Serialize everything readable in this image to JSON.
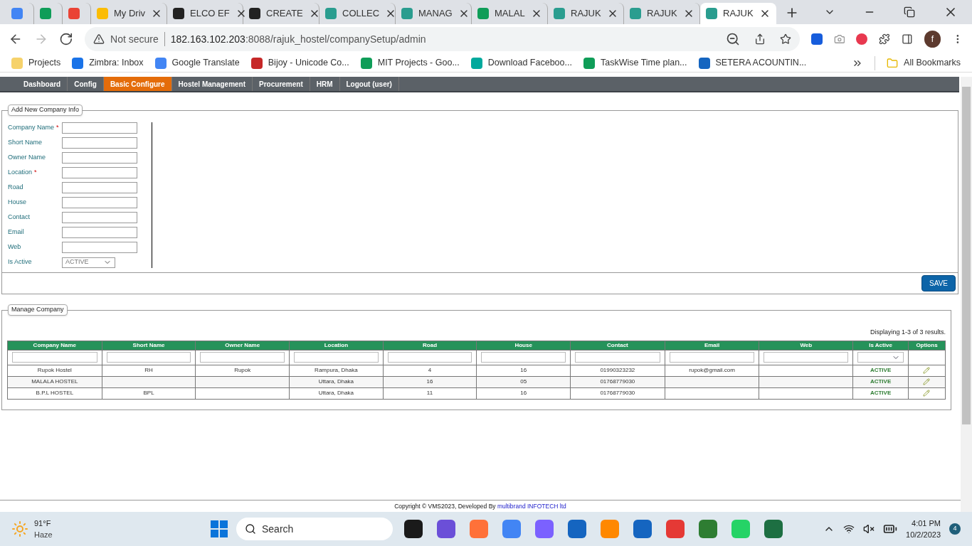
{
  "browser": {
    "tabs": [
      {
        "selected": false
      },
      {
        "selected": false
      },
      {
        "selected": false
      },
      {
        "title": "My Driv",
        "selected": false
      },
      {
        "title": "ELCO EF",
        "selected": false
      },
      {
        "title": "CREATE",
        "selected": false
      },
      {
        "title": "COLLEC",
        "selected": false
      },
      {
        "title": "MANAG",
        "selected": false
      },
      {
        "title": "MALAL",
        "selected": false
      },
      {
        "title": "RAJUK",
        "selected": false
      },
      {
        "title": "RAJUK",
        "selected": false
      },
      {
        "title": "RAJUK",
        "selected": true
      }
    ],
    "security": "Not secure",
    "url_host": "182.163.102.203",
    "url_rest": ":8088/rajuk_hostel/companySetup/admin",
    "profile": "f",
    "bookmarks": [
      "Projects",
      "Zimbra: Inbox",
      "Google Translate",
      "Bijoy - Unicode Co...",
      "MIT Projects - Goo...",
      "Download Faceboo...",
      "TaskWise Time plan...",
      "SETERA ACOUNTIN..."
    ],
    "all_bookmarks": "All Bookmarks"
  },
  "nav": [
    {
      "label": "Dashboard",
      "selected": false
    },
    {
      "label": "Config",
      "selected": false
    },
    {
      "label": "Basic Configure",
      "selected": true
    },
    {
      "label": "Hostel Management",
      "selected": false
    },
    {
      "label": "Procurement",
      "selected": false
    },
    {
      "label": "HRM",
      "selected": false
    },
    {
      "label": "Logout (user)",
      "selected": false
    }
  ],
  "form": {
    "legend": "Add New Company Info",
    "fields": [
      {
        "kind": "text",
        "label": "Company Name",
        "required_mark": "*"
      },
      {
        "kind": "text",
        "label": "Short Name"
      },
      {
        "kind": "text",
        "label": "Owner Name"
      },
      {
        "kind": "text",
        "label": "Location",
        "required_mark": "*"
      },
      {
        "kind": "text",
        "label": "Road"
      },
      {
        "kind": "text",
        "label": "House"
      },
      {
        "kind": "text",
        "label": "Contact"
      },
      {
        "kind": "text",
        "label": "Email"
      },
      {
        "kind": "text",
        "label": "Web"
      },
      {
        "kind": "select",
        "label": "Is Active",
        "value": "ACTIVE"
      }
    ],
    "save": "SAVE"
  },
  "manage": {
    "legend": "Manage Company",
    "summary": "Displaying 1-3 of 3 results.",
    "columns": [
      "Company Name",
      "Short Name",
      "Owner Name",
      "Location",
      "Road",
      "House",
      "Contact",
      "Email",
      "Web",
      "Is Active",
      "Options"
    ],
    "rows": [
      [
        "Rupok Hostel",
        "RH",
        "Rupok",
        "Rampura, Dhaka",
        "4",
        "16",
        "01990323232",
        "rupok@gmail.com",
        "",
        "ACTIVE"
      ],
      [
        "MALALA HOSTEL",
        "",
        "",
        "Uttara, Dhaka",
        "16",
        "05",
        "01768779030",
        "",
        "",
        "ACTIVE"
      ],
      [
        "B.P.L HOSTEL",
        "BPL",
        "",
        "Uttara, Dhaka",
        "11",
        "16",
        "01768779030",
        "",
        "",
        "ACTIVE"
      ]
    ]
  },
  "footer": {
    "text": "Copyright © VMS2023, Developed By ",
    "link": "multibrand INFOTECH ltd"
  },
  "taskbar": {
    "temp": "91°F",
    "weather": "Haze",
    "search": "Search",
    "time": "4:01 PM",
    "date": "10/2/2023",
    "badge": "4"
  }
}
